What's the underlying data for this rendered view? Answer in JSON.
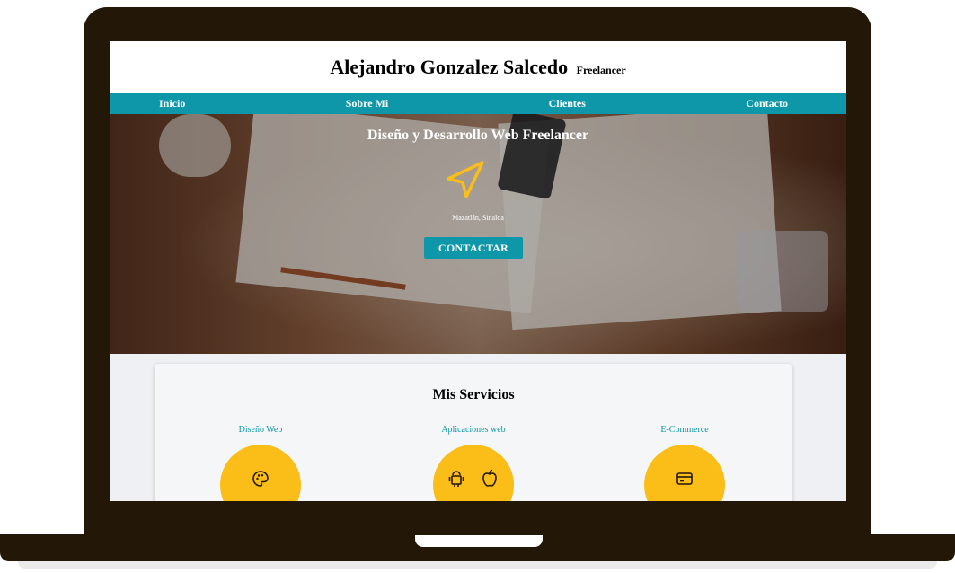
{
  "header": {
    "name": "Alejandro Gonzalez Salcedo",
    "tagline": "Freelancer"
  },
  "nav": {
    "items": [
      {
        "label": "Inicio"
      },
      {
        "label": "Sobre Mi"
      },
      {
        "label": "Clientes"
      },
      {
        "label": "Contacto"
      }
    ]
  },
  "hero": {
    "title": "Diseño y Desarrollo Web Freelancer",
    "icon": "paper-plane-icon",
    "location": "Mazatlán, Sinaloa",
    "cta_label": "CONTACTAR"
  },
  "services": {
    "title": "Mis Servicios",
    "items": [
      {
        "label": "Diseño Web",
        "icon": "palette-icon"
      },
      {
        "label": "Aplicaciones web",
        "icon": "android-apple-icon"
      },
      {
        "label": "E-Commerce",
        "icon": "credit-card-icon"
      }
    ]
  },
  "colors": {
    "accent": "#0d97a8",
    "highlight": "#fbbd17",
    "frame": "#231708"
  }
}
